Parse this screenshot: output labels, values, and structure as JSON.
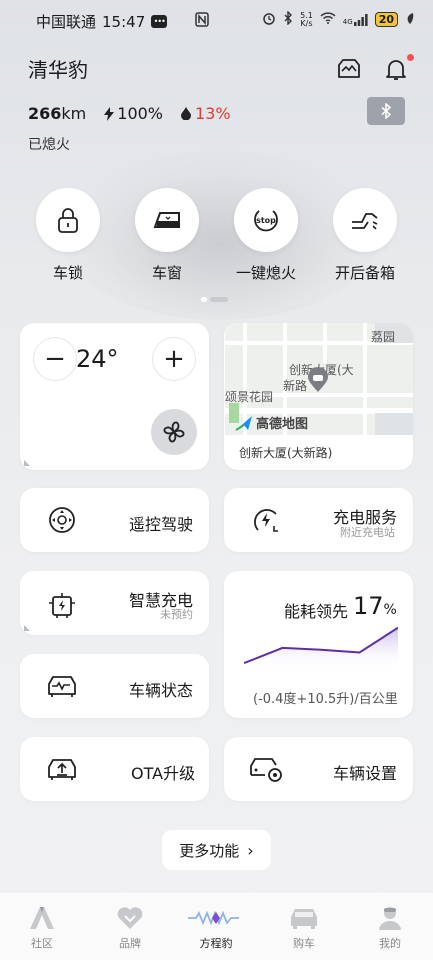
{
  "status_bar": {
    "carrier": "中国联通",
    "time": "15:47",
    "net_speed_top": "5.1",
    "net_speed_unit": "K/s",
    "signal": "4G",
    "battery": "20"
  },
  "header": {
    "title": "清华豹"
  },
  "stats": {
    "range_value": "266",
    "range_unit": "km",
    "battery_pct": "100%",
    "water_pct": "13%",
    "status_text": "已熄火"
  },
  "quick_actions": [
    {
      "label": "车锁",
      "icon": "lock-icon"
    },
    {
      "label": "车窗",
      "icon": "window-icon"
    },
    {
      "label": "一键熄火",
      "icon": "stop-icon",
      "icon_text": "stop"
    },
    {
      "label": "开后备箱",
      "icon": "trunk-icon"
    }
  ],
  "climate": {
    "temp": "24°",
    "minus": "−",
    "plus": "+"
  },
  "map": {
    "place_label": "创新大厦(大新路)",
    "map_texts": [
      "荔园",
      "创新大厦(大",
      "新路",
      "颂景花园",
      "高德地图"
    ]
  },
  "functions": {
    "remote_drive": "遥控驾驶",
    "charging_service": "充电服务",
    "charging_service_sub": "附近充电站",
    "smart_charging": "智慧充电",
    "smart_charging_sub": "未预约",
    "vehicle_status": "车辆状态",
    "ota": "OTA升级",
    "vehicle_settings": "车辆设置"
  },
  "energy": {
    "title": "能耗领先",
    "value": "17",
    "unit": "%",
    "note": "(-0.4度+10.5升)/百公里",
    "series": [
      0.15,
      0.48,
      0.44,
      0.38,
      0.92
    ],
    "line_color": "#5b2fa6"
  },
  "more": {
    "label": "更多功能",
    "chevron": "›"
  },
  "nav": [
    {
      "label": "社区",
      "icon": "community-icon",
      "active": false
    },
    {
      "label": "品牌",
      "icon": "brand-icon",
      "active": false
    },
    {
      "label": "方程豹",
      "icon": "fangchengbao-icon",
      "active": true
    },
    {
      "label": "购车",
      "icon": "car-purchase-icon",
      "active": false
    },
    {
      "label": "我的",
      "icon": "profile-icon",
      "active": false
    }
  ]
}
